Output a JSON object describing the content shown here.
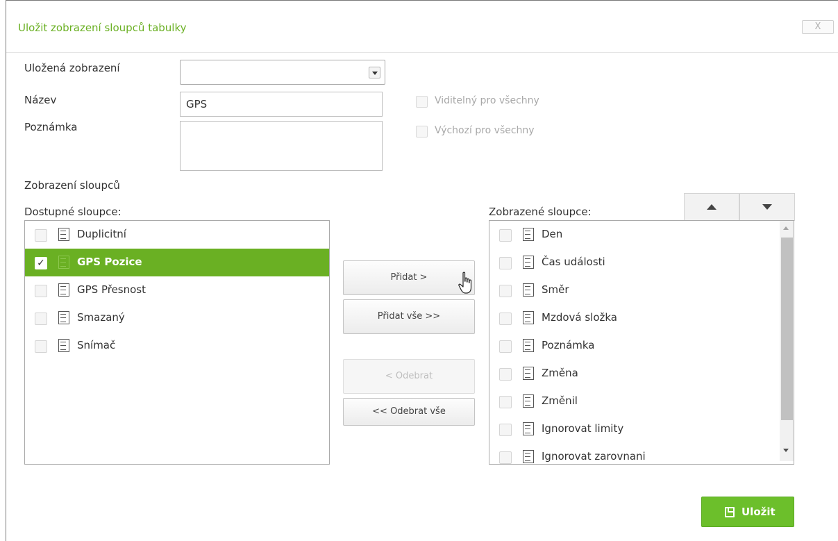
{
  "dialog": {
    "title": "Uložit zobrazení sloupců tabulky",
    "close_label": "X"
  },
  "form": {
    "saved_views_label": "Uložená zobrazení",
    "saved_views_value": "",
    "name_label": "Název",
    "name_value": "GPS",
    "note_label": "Poznámka",
    "note_value": "",
    "visible_for_all_label": "Viditelný pro všechny",
    "default_for_all_label": "Výchozí pro všechny"
  },
  "columns_section": {
    "heading": "Zobrazení sloupců",
    "available_label": "Dostupné sloupce:",
    "displayed_label": "Zobrazené sloupce:"
  },
  "available_columns": [
    {
      "label": "Duplicitní",
      "checked": false,
      "selected": false
    },
    {
      "label": "GPS Pozice",
      "checked": true,
      "selected": true
    },
    {
      "label": "GPS Přesnost",
      "checked": false,
      "selected": false
    },
    {
      "label": "Smazaný",
      "checked": false,
      "selected": false
    },
    {
      "label": "Snímač",
      "checked": false,
      "selected": false
    }
  ],
  "displayed_columns": [
    {
      "label": "Den"
    },
    {
      "label": "Čas události"
    },
    {
      "label": "Směr"
    },
    {
      "label": "Mzdová složka"
    },
    {
      "label": "Poznámka"
    },
    {
      "label": "Změna"
    },
    {
      "label": "Změnil"
    },
    {
      "label": "Ignorovat limity"
    },
    {
      "label": "Ignorovat zarovnani"
    }
  ],
  "transfer_buttons": {
    "add": "Přidat >",
    "add_all": "Přidat vše >>",
    "remove": "< Odebrat",
    "remove_all": "<< Odebrat vše"
  },
  "save_button": {
    "label": "Uložit"
  },
  "colors": {
    "accent": "#6ab023",
    "save_button": "#6cbf2b"
  }
}
